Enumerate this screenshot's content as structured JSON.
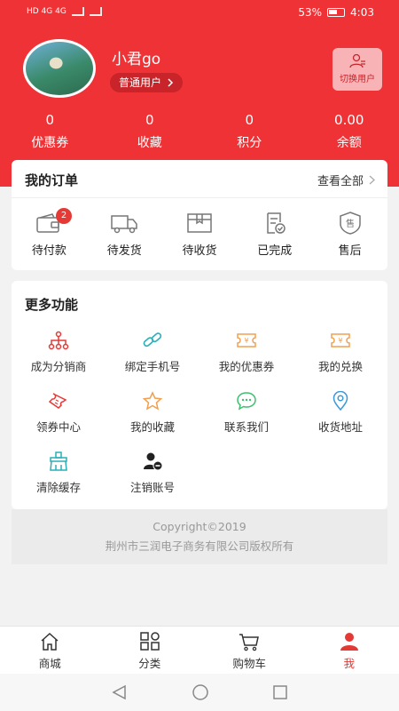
{
  "status_bar": {
    "network": "HD 4G 4G",
    "battery": "53%",
    "time": "4:03"
  },
  "user": {
    "name": "小君go",
    "type": "普通用户",
    "switch_label": "切换用户"
  },
  "stats": [
    {
      "value": "0",
      "label": "优惠券"
    },
    {
      "value": "0",
      "label": "收藏"
    },
    {
      "value": "0",
      "label": "积分"
    },
    {
      "value": "0.00",
      "label": "余额"
    }
  ],
  "orders": {
    "title": "我的订单",
    "view_all": "查看全部",
    "items": [
      {
        "label": "待付款",
        "icon": "wallet-icon",
        "badge": "2"
      },
      {
        "label": "待发货",
        "icon": "truck-icon"
      },
      {
        "label": "待收货",
        "icon": "box-icon"
      },
      {
        "label": "已完成",
        "icon": "check-doc-icon"
      },
      {
        "label": "售后",
        "icon": "after-sale-icon"
      }
    ]
  },
  "more": {
    "title": "更多功能",
    "items": [
      {
        "label": "成为分销商",
        "icon": "distribution-icon"
      },
      {
        "label": "绑定手机号",
        "icon": "link-icon"
      },
      {
        "label": "我的优惠券",
        "icon": "coupon-icon"
      },
      {
        "label": "我的兑换",
        "icon": "exchange-icon"
      },
      {
        "label": "领券中心",
        "icon": "ticket-icon"
      },
      {
        "label": "我的收藏",
        "icon": "star-icon"
      },
      {
        "label": "联系我们",
        "icon": "chat-icon"
      },
      {
        "label": "收货地址",
        "icon": "location-icon"
      },
      {
        "label": "清除缓存",
        "icon": "broom-icon"
      },
      {
        "label": "注销账号",
        "icon": "user-remove-icon"
      }
    ]
  },
  "footer": {
    "copyright": "Copyright©2019",
    "company": "荆州市三润电子商务有限公司版权所有"
  },
  "tabs": [
    {
      "label": "商城",
      "icon": "home-icon"
    },
    {
      "label": "分类",
      "icon": "category-icon"
    },
    {
      "label": "购物车",
      "icon": "cart-icon"
    },
    {
      "label": "我",
      "icon": "user-icon"
    }
  ],
  "colors": {
    "brand": "#ef3236",
    "accent_dark": "#c8242a",
    "badge": "#e53935",
    "orange": "#f0a050",
    "teal": "#2ab0b8",
    "green": "#3cbf70",
    "blue": "#3a9ad9"
  }
}
